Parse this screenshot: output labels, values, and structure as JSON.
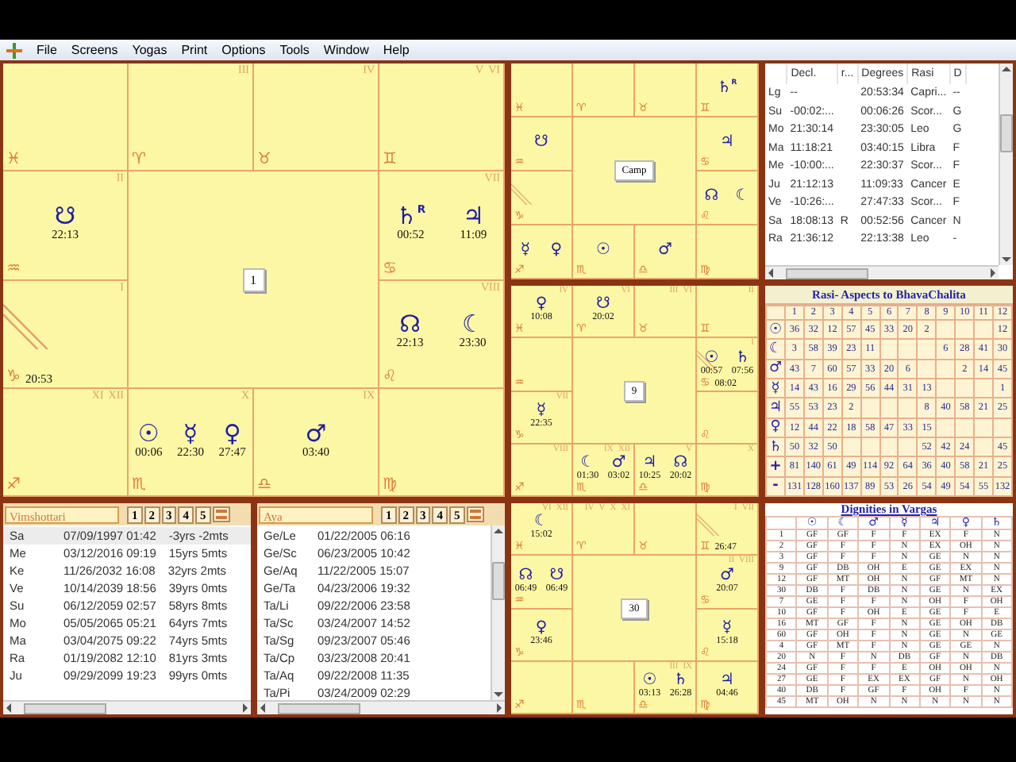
{
  "menu": [
    "File",
    "Screens",
    "Yogas",
    "Print",
    "Options",
    "Tools",
    "Window",
    "Help"
  ],
  "charts": [
    {
      "label": "1",
      "cells": [
        {
          "sign": "♓"
        },
        {
          "sign": "♈",
          "labels": [
            "III"
          ]
        },
        {
          "sign": "♉",
          "labels": [
            "IV"
          ]
        },
        {
          "sign": "♊",
          "labels": [
            "V",
            "VI"
          ]
        },
        {
          "sign": "♒",
          "labels": [
            "II"
          ],
          "planets": [
            {
              "glyph": "☋",
              "time": "22:13"
            }
          ]
        },
        {
          "sign": "♋",
          "labels": [
            "VII"
          ],
          "planets": [
            {
              "glyph": "♄",
              "mark": "R",
              "time": "00:52"
            },
            {
              "glyph": "♃",
              "time": "11:09"
            }
          ]
        },
        {
          "sign": "♑",
          "labels": [
            "I"
          ],
          "ascendant": true,
          "ascendant_time": "20:53"
        },
        {
          "sign": "♌",
          "labels": [
            "VIII"
          ],
          "planets": [
            {
              "glyph": "☊",
              "time": "22:13"
            },
            {
              "glyph": "☾",
              "time": "23:30"
            }
          ]
        },
        {
          "sign": "♐",
          "labels": [
            "XI",
            "XII"
          ]
        },
        {
          "sign": "♏",
          "labels": [
            "X"
          ],
          "planets": [
            {
              "glyph": "☉",
              "time": "00:06"
            },
            {
              "glyph": "☿",
              "time": "22:30"
            },
            {
              "glyph": "♀",
              "time": "27:47"
            }
          ]
        },
        {
          "sign": "♎",
          "labels": [
            "IX"
          ],
          "planets": [
            {
              "glyph": "♂",
              "time": "03:40"
            }
          ]
        },
        {
          "sign": "♍"
        }
      ]
    },
    {
      "label": "Camp",
      "cells": [
        {
          "sign": "♓"
        },
        {
          "sign": "♈"
        },
        {
          "sign": "♉"
        },
        {
          "sign": "♊",
          "planets": [
            {
              "glyph": "♄",
              "mark": "R"
            }
          ]
        },
        {
          "sign": "♒",
          "planets": [
            {
              "glyph": "☋"
            }
          ]
        },
        {
          "sign": "♋",
          "planets": [
            {
              "glyph": "♃"
            }
          ]
        },
        {
          "sign": "♑",
          "ascendant": true
        },
        {
          "sign": "♌",
          "planets": [
            {
              "glyph": "☊"
            },
            {
              "glyph": "☾"
            }
          ]
        },
        {
          "sign": "♐",
          "planets": [
            {
              "glyph": "☿"
            },
            {
              "glyph": "♀"
            }
          ]
        },
        {
          "sign": "♏",
          "planets": [
            {
              "glyph": "☉"
            }
          ]
        },
        {
          "sign": "♎",
          "planets": [
            {
              "glyph": "♂"
            }
          ]
        },
        {
          "sign": "♍"
        }
      ]
    },
    {
      "label": "9",
      "cells": [
        {
          "sign": "♓",
          "labels": [
            "IV"
          ],
          "planets": [
            {
              "glyph": "♀",
              "time": "10:08"
            }
          ]
        },
        {
          "sign": "♈",
          "labels": [
            "VI"
          ],
          "planets": [
            {
              "glyph": "☋",
              "time": "20:02"
            }
          ]
        },
        {
          "sign": "♉",
          "labels": [
            "III",
            "VI"
          ]
        },
        {
          "sign": "♊",
          "labels": [
            "II"
          ]
        },
        {
          "sign": "♒"
        },
        {
          "sign": "♋",
          "labels": [
            "I"
          ],
          "planets": [
            {
              "glyph": "☉",
              "time": "00:57"
            },
            {
              "glyph": "♄",
              "time": "07:56"
            }
          ],
          "ascendant": true,
          "ascendant_time": "08:02"
        },
        {
          "sign": "♑",
          "labels": [
            "VII"
          ],
          "planets": [
            {
              "glyph": "☿",
              "time": "22:35"
            }
          ]
        },
        {
          "sign": "♌"
        },
        {
          "sign": "♐",
          "labels": [
            "VIII"
          ]
        },
        {
          "sign": "♏",
          "labels": [
            "IX",
            "XII"
          ],
          "planets": [
            {
              "glyph": "☾",
              "time": "01:30"
            },
            {
              "glyph": "♂",
              "time": "03:02"
            }
          ]
        },
        {
          "sign": "♎",
          "labels": [
            "V"
          ],
          "planets": [
            {
              "glyph": "♃",
              "time": "10:25"
            },
            {
              "glyph": "☊",
              "time": "20:02"
            }
          ]
        },
        {
          "sign": "♍",
          "labels": [
            "X"
          ]
        }
      ]
    },
    {
      "label": "30",
      "cells": [
        {
          "sign": "♓",
          "labels": [
            "VI",
            "XII"
          ],
          "planets": [
            {
              "glyph": "☾",
              "time": "15:02"
            }
          ]
        },
        {
          "sign": "♈",
          "labels": [
            "IV",
            "V",
            "X",
            "XI"
          ]
        },
        {
          "sign": "♉"
        },
        {
          "sign": "♊",
          "labels": [
            "I",
            "VII"
          ],
          "ascendant": true,
          "ascendant_time": "26:47"
        },
        {
          "sign": "♒",
          "planets": [
            {
              "glyph": "☊",
              "time": "06:49"
            },
            {
              "glyph": "☋",
              "time": "06:49"
            }
          ]
        },
        {
          "sign": "♋",
          "labels": [
            "II",
            "VIII"
          ],
          "planets": [
            {
              "glyph": "♂",
              "time": "20:07"
            }
          ]
        },
        {
          "sign": "♑",
          "planets": [
            {
              "glyph": "♀",
              "time": "23:46"
            }
          ]
        },
        {
          "sign": "♌",
          "planets": [
            {
              "glyph": "☿",
              "time": "15:18"
            }
          ]
        },
        {
          "sign": "♐"
        },
        {
          "sign": "♏"
        },
        {
          "sign": "♎",
          "labels": [
            "III",
            "IX"
          ],
          "planets": [
            {
              "glyph": "☉",
              "time": "03:13"
            },
            {
              "glyph": "♄",
              "time": "26:28"
            }
          ]
        },
        {
          "sign": "♍",
          "planets": [
            {
              "glyph": "♃",
              "time": "04:46"
            }
          ]
        }
      ]
    }
  ],
  "planet_table": {
    "columns": [
      "Decl.",
      "r...",
      "Degrees",
      "Rasi",
      "D"
    ],
    "rows": [
      {
        "planet": "Lg",
        "decl": "--",
        "degrees": "20:53:34",
        "rasi": "Capri...",
        "d": "--"
      },
      {
        "planet": "Su",
        "decl": "-00:02:...",
        "degrees": "00:06:26",
        "rasi": "Scor...",
        "d": "G"
      },
      {
        "planet": "Mo",
        "decl": "21:30:14",
        "degrees": "23:30:05",
        "rasi": "Leo",
        "d": "G"
      },
      {
        "planet": "Ma",
        "decl": "11:18:21",
        "degrees": "03:40:15",
        "rasi": "Libra",
        "d": "F"
      },
      {
        "planet": "Me",
        "decl": "-10:00:...",
        "degrees": "22:30:37",
        "rasi": "Scor...",
        "d": "F"
      },
      {
        "planet": "Ju",
        "decl": "21:12:13",
        "degrees": "11:09:33",
        "rasi": "Cancer",
        "d": "E"
      },
      {
        "planet": "Ve",
        "decl": "-10:26:...",
        "degrees": "27:47:33",
        "rasi": "Scor...",
        "d": "F"
      },
      {
        "planet": "Sa",
        "decl": "18:08:13",
        "retro": "R",
        "degrees": "00:52:56",
        "rasi": "Cancer",
        "d": "N"
      },
      {
        "planet": "Ra",
        "decl": "21:36:12",
        "degrees": "22:13:38",
        "rasi": "Leo",
        "d": "-"
      }
    ]
  },
  "aspects": {
    "title": "Rasi- Aspects to BhavaChalita",
    "columns": [
      "1",
      "2",
      "3",
      "4",
      "5",
      "6",
      "7",
      "8",
      "9",
      "10",
      "11",
      "12"
    ],
    "rows": [
      {
        "planet": "☉",
        "h1": "36",
        "h2": "32",
        "h3": "12",
        "h4": "57",
        "h5": "45",
        "h6": "33",
        "h7": "20",
        "h8": "2",
        "h12": "12"
      },
      {
        "planet": "☾",
        "h1": "3",
        "h2": "58",
        "h3": "39",
        "h4": "23",
        "h5": "11",
        "h9": "6",
        "h10": "28",
        "h11": "41",
        "h12": "30"
      },
      {
        "planet": "♂",
        "h1": "43",
        "h2": "7",
        "h3": "60",
        "h4": "57",
        "h5": "33",
        "h6": "20",
        "h7": "6",
        "h10": "2",
        "h11": "14",
        "h12": "45"
      },
      {
        "planet": "☿",
        "h1": "14",
        "h2": "43",
        "h3": "16",
        "h4": "29",
        "h5": "56",
        "h6": "44",
        "h7": "31",
        "h8": "13",
        "h12": "1"
      },
      {
        "planet": "♃",
        "h1": "55",
        "h2": "53",
        "h3": "23",
        "h4": "2",
        "h8": "8",
        "h9": "40",
        "h10": "58",
        "h11": "21",
        "h12": "25"
      },
      {
        "planet": "♀",
        "h1": "12",
        "h2": "44",
        "h3": "22",
        "h4": "18",
        "h5": "58",
        "h6": "47",
        "h7": "33",
        "h8": "15"
      },
      {
        "planet": "♄",
        "h1": "50",
        "h2": "32",
        "h3": "50",
        "h8": "52",
        "h9": "42",
        "h10": "24",
        "h12": "45"
      },
      {
        "planet": "+",
        "h1": "81",
        "h2": "140",
        "h3": "61",
        "h4": "49",
        "h5": "114",
        "h6": "92",
        "h7": "64",
        "h8": "36",
        "h9": "40",
        "h10": "58",
        "h11": "21",
        "h12": "25"
      },
      {
        "planet": "-",
        "h1": "131",
        "h2": "128",
        "h3": "160",
        "h4": "137",
        "h5": "89",
        "h6": "53",
        "h7": "26",
        "h8": "54",
        "h9": "49",
        "h10": "54",
        "h11": "55",
        "h12": "132"
      }
    ]
  },
  "dasha_panels": [
    {
      "title": "Vimshottari",
      "buttons": [
        "1",
        "2",
        "3",
        "4",
        "5"
      ],
      "rows": [
        {
          "cells": [
            "Sa",
            "07/09/1997 01:42",
            "-3yrs -2mts"
          ],
          "selected": true
        },
        {
          "cells": [
            "Me",
            "03/12/2016 09:19",
            "15yrs 5mts"
          ],
          "selected": false
        },
        {
          "cells": [
            "Ke",
            "11/26/2032 16:08",
            "32yrs 2mts"
          ],
          "selected": false
        },
        {
          "cells": [
            "Ve",
            "10/14/2039 18:56",
            "39yrs 0mts"
          ],
          "selected": false
        },
        {
          "cells": [
            "Su",
            "06/12/2059 02:57",
            "58yrs 8mts"
          ],
          "selected": false
        },
        {
          "cells": [
            "Mo",
            "05/05/2065 05:21",
            "64yrs 7mts"
          ],
          "selected": false
        },
        {
          "cells": [
            "Ma",
            "03/04/2075 09:22",
            "74yrs 5mts"
          ],
          "selected": false
        },
        {
          "cells": [
            "Ra",
            "01/19/2082 12:10",
            "81yrs 3mts"
          ],
          "selected": false
        },
        {
          "cells": [
            "Ju",
            "09/29/2099 19:23",
            "99yrs 0mts"
          ],
          "selected": false
        }
      ]
    },
    {
      "title": "Aya",
      "buttons": [
        "1",
        "2",
        "3",
        "4",
        "5"
      ],
      "rows": [
        {
          "cells": [
            "Ge/Le",
            "01/22/2005 06:16"
          ],
          "selected": false
        },
        {
          "cells": [
            "Ge/Sc",
            "06/23/2005 10:42"
          ],
          "selected": false
        },
        {
          "cells": [
            "Ge/Aq",
            "11/22/2005 15:07"
          ],
          "selected": false
        },
        {
          "cells": [
            "Ge/Ta",
            "04/23/2006 19:32"
          ],
          "selected": false
        },
        {
          "cells": [
            "Ta/Li",
            "09/22/2006 23:58"
          ],
          "selected": false
        },
        {
          "cells": [
            "Ta/Sc",
            "03/24/2007 14:52"
          ],
          "selected": false
        },
        {
          "cells": [
            "Ta/Sg",
            "09/23/2007 05:46"
          ],
          "selected": false
        },
        {
          "cells": [
            "Ta/Cp",
            "03/23/2008 20:41"
          ],
          "selected": false
        },
        {
          "cells": [
            "Ta/Aq",
            "09/22/2008 11:35"
          ],
          "selected": false
        },
        {
          "cells": [
            "Ta/Pi",
            "03/24/2009 02:29"
          ],
          "selected": false
        }
      ]
    }
  ],
  "dignities": {
    "title": "Dignities in Vargas",
    "columns": [
      "☉",
      "☾",
      "♂",
      "☿",
      "♃",
      "♀",
      "♄"
    ],
    "rows": [
      {
        "varga": "1",
        "values": [
          "GF",
          "GF",
          "F",
          "F",
          "EX",
          "F",
          "N"
        ]
      },
      {
        "varga": "2",
        "values": [
          "GF",
          "F",
          "F",
          "N",
          "EX",
          "OH",
          "N"
        ]
      },
      {
        "varga": "3",
        "values": [
          "GF",
          "F",
          "F",
          "N",
          "GE",
          "N",
          "N"
        ]
      },
      {
        "varga": "9",
        "values": [
          "GF",
          "DB",
          "OH",
          "E",
          "GE",
          "EX",
          "N"
        ]
      },
      {
        "varga": "12",
        "values": [
          "GF",
          "MT",
          "OH",
          "N",
          "GF",
          "MT",
          "N"
        ]
      },
      {
        "varga": "30",
        "values": [
          "DB",
          "F",
          "DB",
          "N",
          "GE",
          "N",
          "EX"
        ]
      },
      {
        "varga": "7",
        "values": [
          "GE",
          "F",
          "F",
          "N",
          "OH",
          "F",
          "OH"
        ]
      },
      {
        "varga": "10",
        "values": [
          "GF",
          "F",
          "OH",
          "E",
          "GE",
          "F",
          "E"
        ]
      },
      {
        "varga": "16",
        "values": [
          "MT",
          "GF",
          "F",
          "N",
          "GE",
          "OH",
          "DB"
        ]
      },
      {
        "varga": "60",
        "values": [
          "GF",
          "OH",
          "F",
          "N",
          "GE",
          "N",
          "GE"
        ]
      },
      {
        "varga": "4",
        "values": [
          "GF",
          "MT",
          "F",
          "N",
          "GE",
          "GE",
          "N"
        ]
      },
      {
        "varga": "20",
        "values": [
          "N",
          "F",
          "N",
          "DB",
          "GF",
          "N",
          "DB"
        ]
      },
      {
        "varga": "24",
        "values": [
          "GF",
          "F",
          "F",
          "E",
          "OH",
          "OH",
          "N"
        ]
      },
      {
        "varga": "27",
        "values": [
          "GE",
          "F",
          "EX",
          "EX",
          "GF",
          "N",
          "OH"
        ]
      },
      {
        "varga": "40",
        "values": [
          "DB",
          "F",
          "GF",
          "F",
          "OH",
          "F",
          "N"
        ]
      },
      {
        "varga": "45",
        "values": [
          "MT",
          "OH",
          "N",
          "N",
          "N",
          "N",
          "N"
        ]
      }
    ]
  }
}
